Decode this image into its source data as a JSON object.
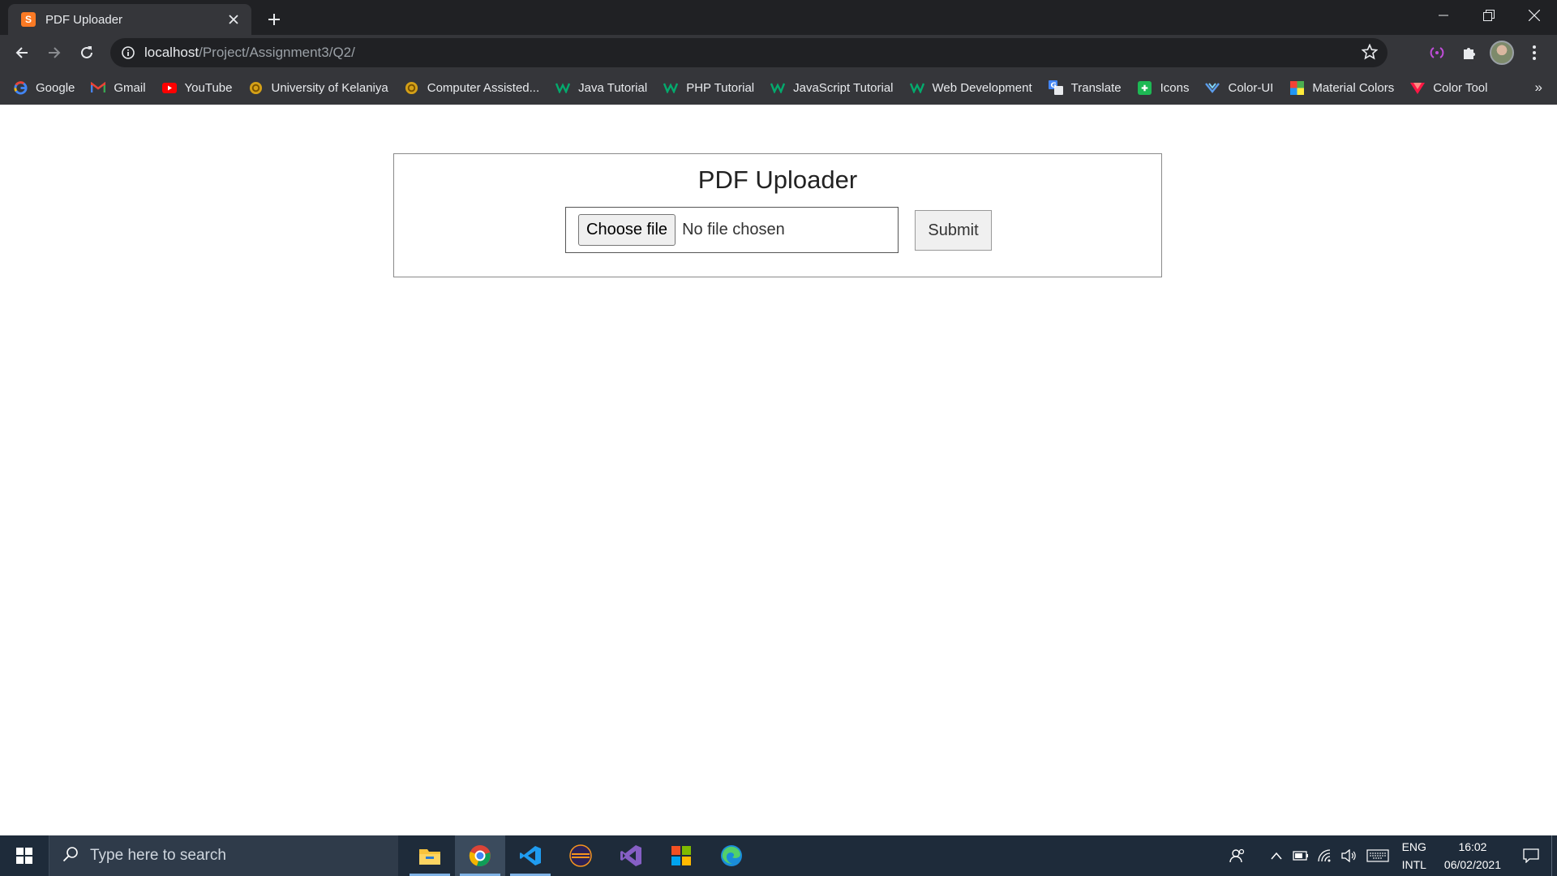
{
  "browser": {
    "tab_title": "PDF Uploader",
    "tab_favicon_label": "S",
    "url_host": "localhost",
    "url_path": "/Project/Assignment3/Q2/",
    "bookmarks": [
      {
        "label": "Google",
        "icon": "google-icon",
        "color": "#4285f4"
      },
      {
        "label": "Gmail",
        "icon": "gmail-icon",
        "color": "#ea4335"
      },
      {
        "label": "YouTube",
        "icon": "youtube-icon",
        "color": "#ff0000"
      },
      {
        "label": "University of Kelaniya",
        "icon": "university-icon",
        "color": "#d4a017"
      },
      {
        "label": "Computer Assisted...",
        "icon": "university-icon",
        "color": "#d4a017"
      },
      {
        "label": "Java Tutorial",
        "icon": "w3schools-icon",
        "color": "#04aa6d"
      },
      {
        "label": "PHP Tutorial",
        "icon": "w3schools-icon",
        "color": "#04aa6d"
      },
      {
        "label": "JavaScript Tutorial",
        "icon": "w3schools-icon",
        "color": "#04aa6d"
      },
      {
        "label": "Web Development",
        "icon": "w3schools-icon",
        "color": "#04aa6d"
      },
      {
        "label": "Translate",
        "icon": "translate-icon",
        "color": "#4285f4"
      },
      {
        "label": "Icons",
        "icon": "icons-icon",
        "color": "#1db954"
      },
      {
        "label": "Color-UI",
        "icon": "color-ui-icon",
        "color": "#5c9ded"
      },
      {
        "label": "Material Colors",
        "icon": "material-colors-icon",
        "color": "#f44336"
      },
      {
        "label": "Color Tool",
        "icon": "color-tool-icon",
        "color": "#ff1744"
      }
    ],
    "bookmarks_more": "»"
  },
  "page": {
    "title": "PDF Uploader",
    "choose_file_label": "Choose file",
    "file_status": "No file chosen",
    "submit_label": "Submit"
  },
  "taskbar": {
    "search_placeholder": "Type here to search",
    "lang_line1": "ENG",
    "lang_line2": "INTL",
    "time": "16:02",
    "date": "06/02/2021"
  },
  "colors": {
    "chrome_dark": "#202124",
    "chrome_mid": "#35363a",
    "taskbar": "#1e2b3a"
  }
}
